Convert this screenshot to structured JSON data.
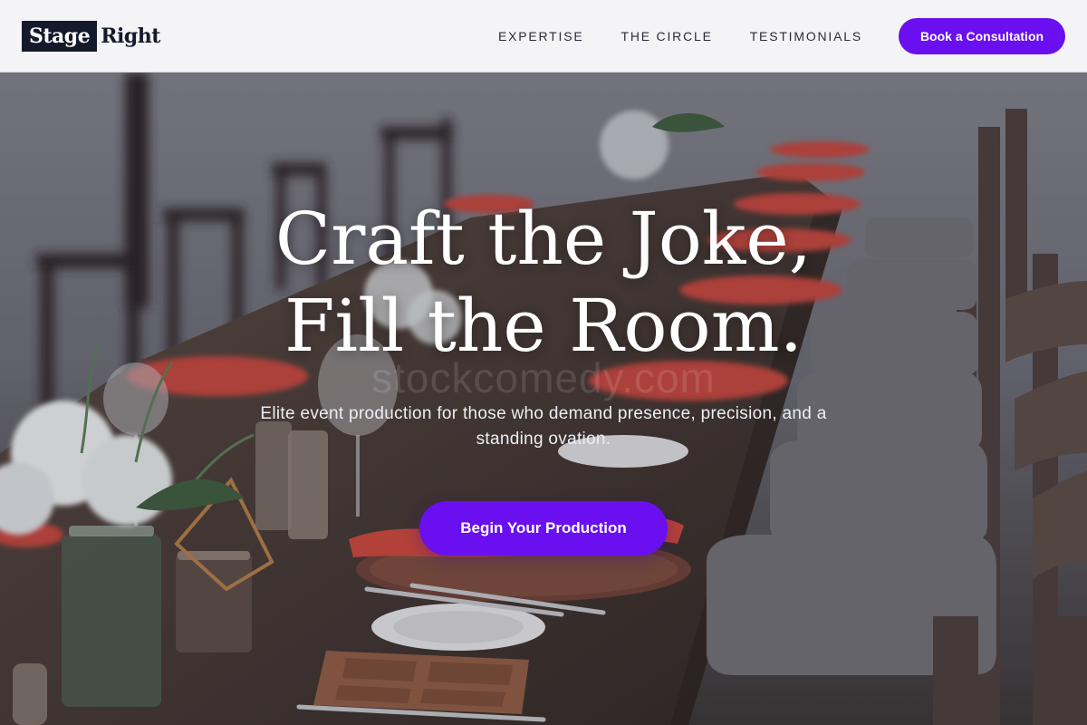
{
  "header": {
    "logo": {
      "boxed": "Stage",
      "text": "Right"
    },
    "nav": [
      {
        "label": "EXPERTISE"
      },
      {
        "label": "THE CIRCLE"
      },
      {
        "label": "TESTIMONIALS"
      }
    ],
    "cta_label": "Book a Consultation"
  },
  "hero": {
    "title_line1": "Craft the Joke,",
    "title_line2": "Fill the Room.",
    "subtitle": "Elite event production for those who demand presence, precision, and a standing ovation.",
    "cta_label": "Begin Your Production",
    "watermark": "stockcomedy.com",
    "background_image": "banquet-table-photo"
  },
  "colors": {
    "accent": "#6a0ff0",
    "logo_dark": "#141a2c",
    "header_bg": "#f4f4f6",
    "napkin_red": "#c0443c"
  }
}
